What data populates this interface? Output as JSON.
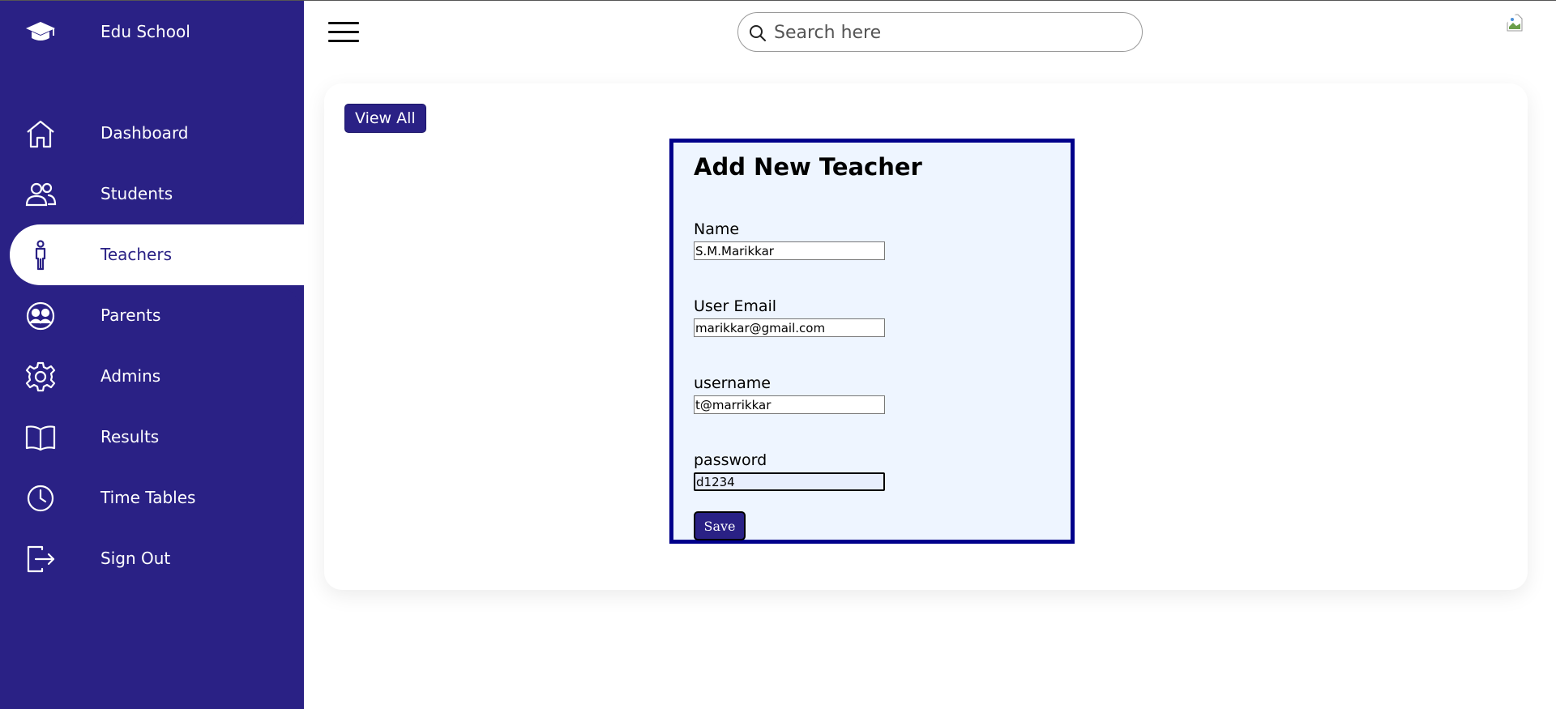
{
  "brand": {
    "name": "Edu School",
    "icon": "graduation-cap-icon"
  },
  "sidebar": {
    "items": [
      {
        "label": "Dashboard",
        "icon": "home-icon"
      },
      {
        "label": "Students",
        "icon": "people-icon"
      },
      {
        "label": "Teachers",
        "icon": "person-icon",
        "active": true
      },
      {
        "label": "Parents",
        "icon": "people-circle-icon"
      },
      {
        "label": "Admins",
        "icon": "gear-icon"
      },
      {
        "label": "Results",
        "icon": "book-icon"
      },
      {
        "label": "Time Tables",
        "icon": "clock-icon"
      },
      {
        "label": "Sign Out",
        "icon": "logout-icon"
      }
    ]
  },
  "topbar": {
    "search_placeholder": "Search here"
  },
  "main": {
    "view_all_label": "View All",
    "form": {
      "title": "Add New Teacher",
      "fields": [
        {
          "label": "Name",
          "value": "S.M.Marikkar"
        },
        {
          "label": "User Email",
          "value": "marikkar@gmail.com"
        },
        {
          "label": "username",
          "value": "t@marrikkar"
        },
        {
          "label": "password",
          "value": "d1234"
        }
      ],
      "save_label": "Save"
    }
  },
  "colors": {
    "sidebar": "#2a2185",
    "form_border": "#00008b",
    "form_bg": "#eef5ff"
  }
}
